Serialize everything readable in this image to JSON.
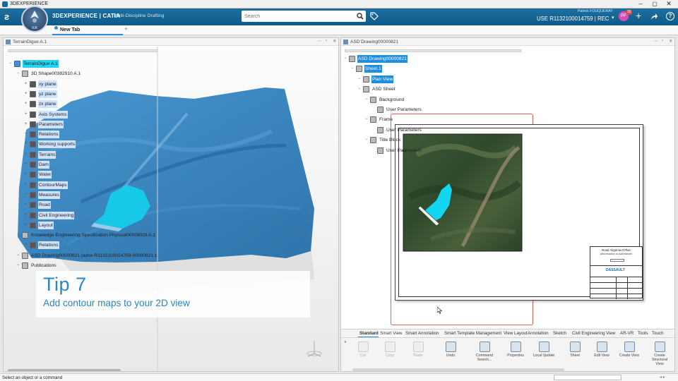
{
  "app": {
    "window_title": "3DEXPERIENCE",
    "brand": "3DEXPERIENCE | CATIA",
    "app_name": "Multi-Discipline Drafting",
    "version": "V.R",
    "user_name": "Patrick FOUQUERAY",
    "context": "USE R1132100014759 | REC",
    "badge": "10"
  },
  "search": {
    "placeholder": "Search"
  },
  "tabs": {
    "new_tab": "New Tab",
    "add": "+"
  },
  "left_panel": {
    "title": "TerrainDigue A.1",
    "tree": [
      {
        "label": "TerrainDigue A.1",
        "lvl": 0,
        "sel": "cyan"
      },
      {
        "label": "3D Shape00382910 A.1",
        "lvl": 1
      },
      {
        "label": "xy plane",
        "lvl": 2
      },
      {
        "label": "yz plane",
        "lvl": 2
      },
      {
        "label": "zx plane",
        "lvl": 2
      },
      {
        "label": "Axis Systems",
        "lvl": 2
      },
      {
        "label": "Parameters",
        "lvl": 2
      },
      {
        "label": "Relations",
        "lvl": 2
      },
      {
        "label": "Working supports",
        "lvl": 2
      },
      {
        "label": "Terrains",
        "lvl": 2
      },
      {
        "label": "Dam",
        "lvl": 2
      },
      {
        "label": "Water",
        "lvl": 2
      },
      {
        "label": "ContourMaps",
        "lvl": 2
      },
      {
        "label": "Measures",
        "lvl": 2
      },
      {
        "label": "Road",
        "lvl": 2
      },
      {
        "label": "Civil Engineering",
        "lvl": 2
      },
      {
        "label": "Layout",
        "lvl": 2
      },
      {
        "label": "Knowledge Engineering Specification Physical00009029 A.1",
        "lvl": 1
      },
      {
        "label": "Relations",
        "lvl": 2
      },
      {
        "label": "ASD Drawing00000821 (adrw-R1132100014759-00000821.1",
        "lvl": 1
      },
      {
        "label": "Publications",
        "lvl": 1
      }
    ]
  },
  "tip": {
    "title": "Tip 7",
    "subtitle": "Add contour maps to your 2D view"
  },
  "right_panel": {
    "title": "ASD Drawing00000821",
    "tree": [
      {
        "label": "ASD Drawing00000821",
        "lvl": 0,
        "sel": "blue"
      },
      {
        "label": "Sheet.1",
        "lvl": 1,
        "sel": "blue"
      },
      {
        "label": "Plan View",
        "lvl": 2,
        "sel": "blue"
      },
      {
        "label": "ASD Sheet",
        "lvl": 2
      },
      {
        "label": "Background",
        "lvl": 3
      },
      {
        "label": "User Parameters",
        "lvl": 4
      },
      {
        "label": "Frame",
        "lvl": 3
      },
      {
        "label": "User Parameters",
        "lvl": 4
      },
      {
        "label": "Title Block",
        "lvl": 3
      },
      {
        "label": "User Parameters",
        "lvl": 4
      }
    ],
    "title_block": {
      "heading": "Road Alignment Plan",
      "sub": "Afforestation to Alahrfalnen",
      "logo": "DASSAULT"
    }
  },
  "ribbon": {
    "tabs": [
      "Standard",
      "Smart View",
      "Smart Annotation",
      "Smart Template Management",
      "View Layout",
      "Annotation",
      "Sketch",
      "Civil Engineering",
      "View",
      "AR-VR",
      "Tools",
      "Touch"
    ],
    "tools": [
      {
        "label": "Cut",
        "enabled": false
      },
      {
        "label": "Copy",
        "enabled": false
      },
      {
        "label": "Paste",
        "enabled": false
      },
      {
        "label": "Undo",
        "enabled": true
      },
      {
        "label": "Command Search...",
        "enabled": true
      },
      {
        "label": "Properties",
        "enabled": true
      },
      {
        "label": "Local Update",
        "enabled": true
      },
      {
        "label": "Sheet",
        "enabled": true
      },
      {
        "label": "Edit View",
        "enabled": true
      },
      {
        "label": "Create View",
        "enabled": true
      },
      {
        "label": "Create Structural View",
        "enabled": true
      }
    ]
  },
  "status": {
    "text": "Select an object or a command"
  },
  "colors": {
    "topbar": "#1669a0",
    "selection": "#1f8de0",
    "highlight_cyan": "#22d4f3",
    "terrain": "#2c80c2",
    "water": "#12d5f0",
    "sheet_outline": "#e06060"
  }
}
